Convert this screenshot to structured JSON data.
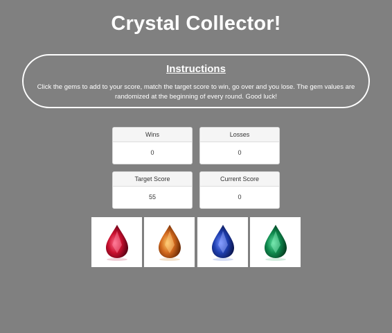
{
  "header": {
    "title": "Crystal Collector!"
  },
  "instructions": {
    "heading": "Instructions",
    "text": "Click the gems to add to your score, match the target score to win, go over and you lose. The gem values are randomized at the beginning of every round. Good luck!"
  },
  "stats": {
    "wins": {
      "label": "Wins",
      "value": "0"
    },
    "losses": {
      "label": "Losses",
      "value": "0"
    },
    "target": {
      "label": "Target Score",
      "value": "55"
    },
    "current": {
      "label": "Current Score",
      "value": "0"
    }
  },
  "gems": [
    {
      "icon": "ruby-gem-icon",
      "color": "#c8102e"
    },
    {
      "icon": "topaz-gem-icon",
      "color": "#d2691e"
    },
    {
      "icon": "sapphire-gem-icon",
      "color": "#1f3fb0"
    },
    {
      "icon": "emerald-gem-icon",
      "color": "#0f8a4e"
    }
  ]
}
